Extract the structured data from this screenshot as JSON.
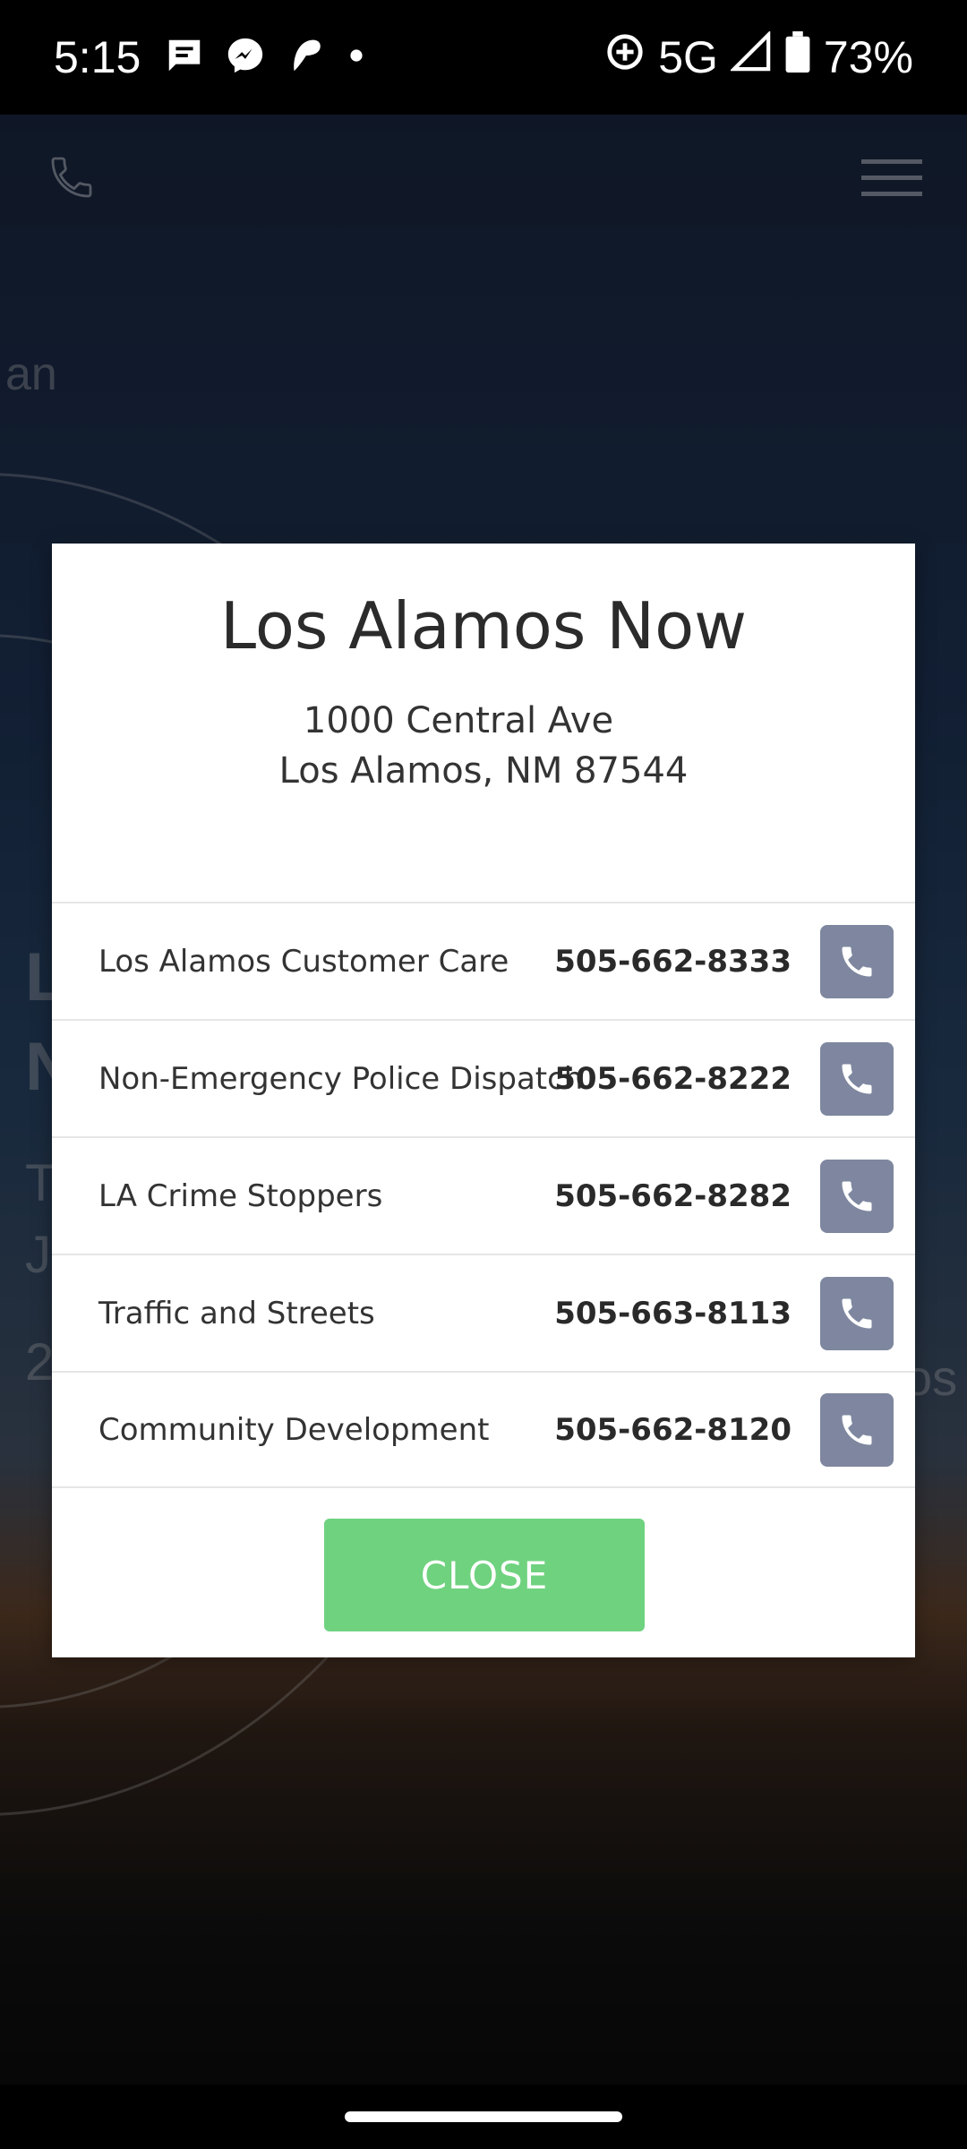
{
  "status_bar": {
    "time": "5:15",
    "network": "5G",
    "battery": "73%",
    "icons": [
      "messages-icon",
      "messenger-icon",
      "app-icon",
      "dot-icon",
      "sync-icon",
      "signal-icon",
      "battery-icon"
    ]
  },
  "background": {
    "left_fragments": [
      "an",
      "L",
      "N",
      "T",
      "Ja",
      "2"
    ],
    "right_fragment": "os"
  },
  "modal": {
    "title": "Los Alamos Now",
    "address_line1": "1000 Central Ave",
    "address_line2": "Los Alamos, NM 87544",
    "contacts": [
      {
        "name": "Los Alamos Customer Care",
        "phone": "505-662-8333"
      },
      {
        "name": "Non-Emergency Police Dispatch",
        "phone": "505-662-8222"
      },
      {
        "name": "LA Crime Stoppers",
        "phone": "505-662-8282"
      },
      {
        "name": "Traffic and Streets",
        "phone": "505-663-8113"
      },
      {
        "name": "Community Development",
        "phone": "505-662-8120"
      }
    ],
    "close_label": "CLOSE"
  },
  "colors": {
    "call_button": "#7e879f",
    "close_button": "#6fd27f"
  }
}
